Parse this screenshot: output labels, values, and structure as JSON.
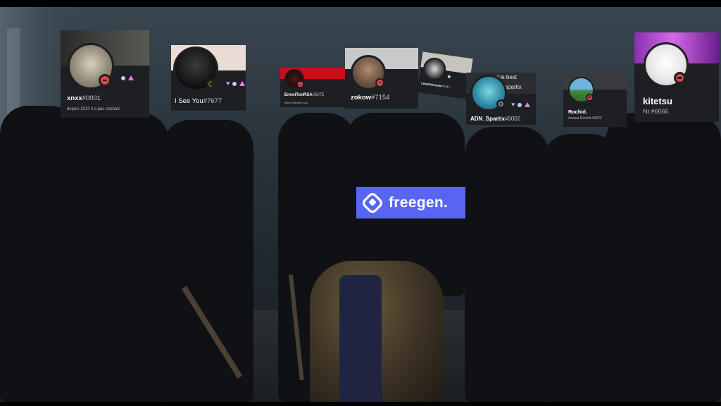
{
  "overlay_logo": {
    "text": "freegen."
  },
  "cards": [
    {
      "name": "xnxx",
      "tag": "#0001",
      "subtitle": "depuis 2010 il a pas chahad"
    },
    {
      "name": "I See You",
      "tag": "#7677"
    },
    {
      "name": "EnvoiTonRSA",
      "tag": "#5075",
      "subtitle": "https://fgingen.xyz/"
    },
    {
      "name": "zokow",
      "tag": "#7154"
    },
    {
      "name": "Lmaoheccow",
      "tag": "#5447"
    },
    {
      "name": "ADN_Spartix",
      "tag": "#0002",
      "banner_text_1": "t le best",
      "banner_text_2": "nd spartix"
    },
    {
      "name": "Rachid.",
      "subtitle": "Axxuat Rachid.#3623"
    },
    {
      "name": "kitetsu",
      "subtitle": "Nt.#6666"
    }
  ],
  "colors": {
    "card_bg": "#1e1f22",
    "dnd_red": "#e0444b",
    "brand_blurple": "#5865f2"
  }
}
